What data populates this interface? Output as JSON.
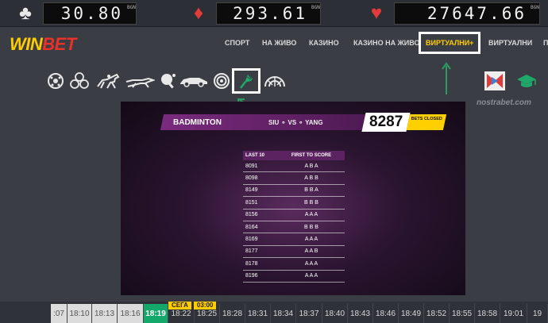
{
  "jackpots": [
    {
      "suit": "club-icon",
      "glyph": "♣",
      "color": "#e8e8e8",
      "value": "30.80",
      "currency": "BGN"
    },
    {
      "suit": "diamond-icon",
      "glyph": "♦",
      "color": "#e23b3b",
      "value": "293.61",
      "currency": "BGN"
    },
    {
      "suit": "heart-icon",
      "glyph": "♥",
      "color": "#e23b3b",
      "value": "27647.66",
      "currency": "BGN"
    }
  ],
  "brand": {
    "logo_part1": "WIN",
    "logo_part2": "BET"
  },
  "nav": {
    "items": [
      "СПОРТ",
      "НА ЖИВО",
      "КАЗИНО",
      "КАЗИНО НА ЖИВО",
      "ВИРТУАЛНИ+",
      "ВИРТУАЛНИ",
      "П"
    ],
    "active_index": 4
  },
  "sports_icons": [
    "football-icon",
    "multi-ball-icon",
    "horse-racing-icon",
    "dog-racing-icon",
    "table-tennis-icon",
    "car-racing-icon",
    "archery-target-icon",
    "badminton-icon",
    "keno-wheel-icon"
  ],
  "side_icons": [
    "video-play-icon",
    "graduation-cap-icon"
  ],
  "watermark": "nostrabet.com",
  "event": {
    "sport": "BADMINTON",
    "match": "SIU ⚬ VS ⚬ YANG",
    "id": "8287",
    "status": "BETS CLOSED"
  },
  "results_table": {
    "headers": [
      "LAST 10",
      "FIRST TO SCORE"
    ],
    "rows": [
      [
        "8091",
        "A B A"
      ],
      [
        "8098",
        "A B B"
      ],
      [
        "8149",
        "B B A"
      ],
      [
        "8151",
        "B B B"
      ],
      [
        "8156",
        "A A A"
      ],
      [
        "8164",
        "B B B"
      ],
      [
        "8169",
        "A A A"
      ],
      [
        "8177",
        "A A B"
      ],
      [
        "8178",
        "A A A"
      ],
      [
        "8196",
        "A A A"
      ]
    ]
  },
  "timeline": {
    "now_label": "СЕГА",
    "countdown": "03:00",
    "slots": [
      ":07",
      "18:10",
      "18:13",
      "18:16",
      "18:19",
      "18:22",
      "18:25",
      "18:28",
      "18:31",
      "18:34",
      "18:37",
      "18:40",
      "18:43",
      "18:46",
      "18:49",
      "18:52",
      "18:55",
      "18:58",
      "19:01",
      "19"
    ],
    "current_index": 4
  }
}
